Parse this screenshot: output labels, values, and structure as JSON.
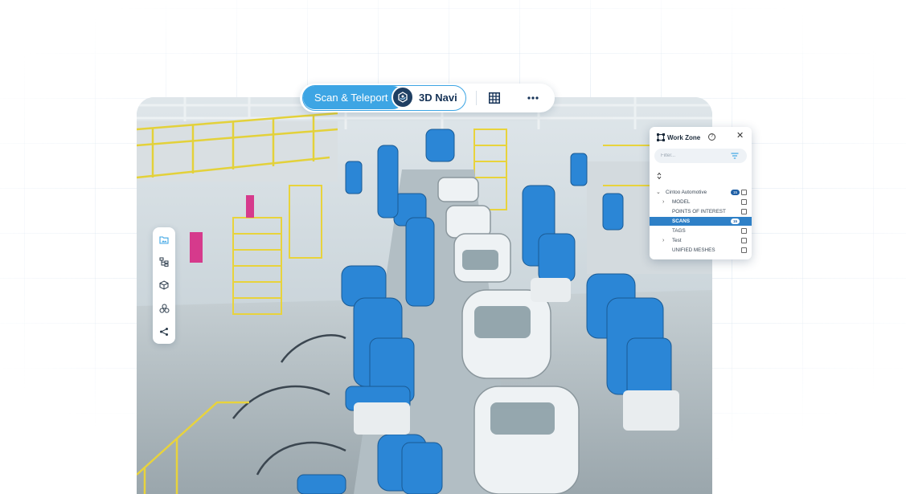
{
  "toolbar": {
    "mode_active_label": "Scan & Teleport",
    "mode_inactive_label": "3D Navi",
    "grid_icon": "grid-icon",
    "more_icon": "more-icon"
  },
  "rail": {
    "items": [
      {
        "icon": "folder-image-icon"
      },
      {
        "icon": "hierarchy-icon"
      },
      {
        "icon": "cube-icon"
      },
      {
        "icon": "layers-icon"
      },
      {
        "icon": "share-icon"
      }
    ]
  },
  "panel": {
    "title": "Work Zone",
    "help_glyph": "?",
    "close_glyph": "✕",
    "filter_placeholder": "Filter...",
    "tree": [
      {
        "label": "Cintoo Automotive",
        "badge": "15",
        "expandable": true,
        "expanded": true,
        "level": 0
      },
      {
        "label": "MODEL",
        "expandable": true,
        "level": 1
      },
      {
        "label": "POINTS OF INTEREST",
        "level": 1
      },
      {
        "label": "SCANS",
        "badge": "15",
        "level": 1,
        "selected": true
      },
      {
        "label": "TAGS",
        "level": 1
      },
      {
        "label": "Test",
        "expandable": true,
        "level": 1
      },
      {
        "label": "UNIFIED MESHES",
        "level": 1
      }
    ]
  },
  "colors": {
    "accent": "#3da5e4",
    "navy": "#163357",
    "selected": "#2e80c7",
    "robot_blue": "#2b86d6",
    "rail_yellow": "#e8d33c"
  }
}
